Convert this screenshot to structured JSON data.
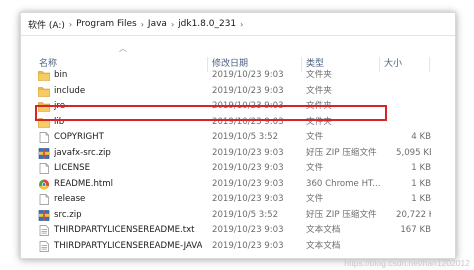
{
  "breadcrumb": {
    "items": [
      "软件 (A:)",
      "Program Files",
      "Java",
      "jdk1.8.0_231"
    ],
    "separator": "›"
  },
  "columns": {
    "name": "名称",
    "date": "修改日期",
    "type": "类型",
    "size": "大小"
  },
  "files": [
    {
      "name": "bin",
      "date": "2019/10/23 9:03",
      "type": "文件夹",
      "size": "",
      "icon": "folder-icon"
    },
    {
      "name": "include",
      "date": "2019/10/23 9:03",
      "type": "文件夹",
      "size": "",
      "icon": "folder-icon"
    },
    {
      "name": "jre",
      "date": "2019/10/23 9:03",
      "type": "文件夹",
      "size": "",
      "icon": "folder-icon"
    },
    {
      "name": "lib",
      "date": "2019/10/23 9:03",
      "type": "文件夹",
      "size": "",
      "icon": "folder-icon"
    },
    {
      "name": "COPYRIGHT",
      "date": "2019/10/5 3:52",
      "type": "文件",
      "size": "4 KB",
      "icon": "file-icon"
    },
    {
      "name": "javafx-src.zip",
      "date": "2019/10/23 9:03",
      "type": "好压 ZIP 压缩文件",
      "size": "5,095 KB",
      "icon": "zip-icon"
    },
    {
      "name": "LICENSE",
      "date": "2019/10/23 9:03",
      "type": "文件",
      "size": "1 KB",
      "icon": "file-icon"
    },
    {
      "name": "README.html",
      "date": "2019/10/23 9:03",
      "type": "360 Chrome HT...",
      "size": "1 KB",
      "icon": "html-icon"
    },
    {
      "name": "release",
      "date": "2019/10/23 9:03",
      "type": "文件",
      "size": "1 KB",
      "icon": "file-icon"
    },
    {
      "name": "src.zip",
      "date": "2019/10/5 3:52",
      "type": "好压 ZIP 压缩文件",
      "size": "20,722 KB",
      "icon": "zip-icon"
    },
    {
      "name": "THIRDPARTYLICENSEREADME.txt",
      "date": "2019/10/23 9:03",
      "type": "文本文档",
      "size": "167 KB",
      "icon": "text-icon"
    },
    {
      "name": "THIRDPARTYLICENSEREADME-JAVAF...",
      "date": "2019/10/23 9:03",
      "type": "文本文档",
      "size": "",
      "icon": "text-icon"
    }
  ],
  "highlight_row_name": "jre",
  "colors": {
    "highlight": "#d9232b",
    "folder": "#e8b84a",
    "header_text": "#4d6082"
  },
  "watermark": "https://blog.csdn.net/han1202012"
}
